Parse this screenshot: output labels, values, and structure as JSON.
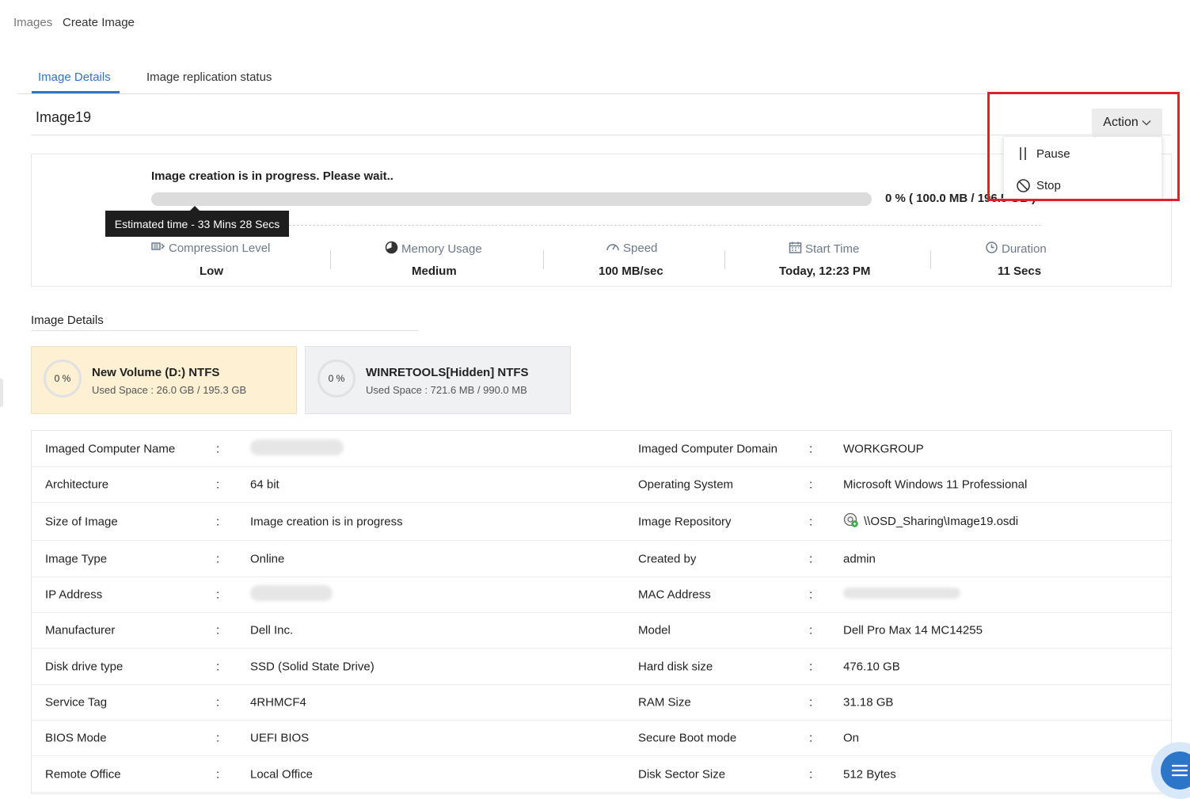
{
  "breadcrumb": [
    "Images",
    "Create Image"
  ],
  "tabs": [
    {
      "label": "Image Details",
      "active": true
    },
    {
      "label": "Image replication status",
      "active": false
    }
  ],
  "image_name": "Image19",
  "action": {
    "button_label": "Action",
    "menu": [
      {
        "label": "Pause",
        "icon": "pause-icon"
      },
      {
        "label": "Stop",
        "icon": "stop-icon"
      }
    ]
  },
  "progress": {
    "message": "Image creation is in progress. Please wait..",
    "percent": 0,
    "summary": "0 % ( 100.0 MB / 196.5 GB )",
    "tooltip": "Estimated time - 33 Mins 28 Secs"
  },
  "stats": [
    {
      "label": "Compression Level",
      "value": "Low",
      "icon": "compression-icon"
    },
    {
      "label": "Memory Usage",
      "value": "Medium",
      "icon": "memory-pie-icon"
    },
    {
      "label": "Speed",
      "value": "100 MB/sec",
      "icon": "speedometer-icon"
    },
    {
      "label": "Start Time",
      "value": "Today, 12:23 PM",
      "icon": "calendar-icon"
    },
    {
      "label": "Duration",
      "value": "11 Secs",
      "icon": "clock-icon"
    }
  ],
  "section_title": "Image Details",
  "volumes": [
    {
      "percent": "0 %",
      "name": "New Volume (D:) NTFS",
      "used": "Used Space : 26.0 GB / 195.3 GB"
    },
    {
      "percent": "0 %",
      "name": "WINRETOOLS[Hidden] NTFS",
      "used": "Used Space : 721.6 MB / 990.0 MB"
    }
  ],
  "details": [
    {
      "label1": "Imaged Computer Name",
      "value1": "",
      "label2": "Imaged Computer Domain",
      "value2": "WORKGROUP"
    },
    {
      "label1": "Architecture",
      "value1": "64 bit",
      "label2": "Operating System",
      "value2": "Microsoft Windows 11 Professional"
    },
    {
      "label1": "Size of Image",
      "value1": "Image creation is in progress",
      "label2": "Image Repository",
      "value2": "\\\\OSD_Sharing\\Image19.osdi"
    },
    {
      "label1": "Image Type",
      "value1": "Online",
      "label2": "Created by",
      "value2": "admin"
    },
    {
      "label1": "IP Address",
      "value1": "",
      "label2": "MAC Address",
      "value2": ""
    },
    {
      "label1": "Manufacturer",
      "value1": "Dell Inc.",
      "label2": "Model",
      "value2": "Dell Pro Max 14 MC14255"
    },
    {
      "label1": "Disk drive type",
      "value1": "SSD (Solid State Drive)",
      "label2": "Hard disk size",
      "value2": "476.10 GB"
    },
    {
      "label1": "Service Tag",
      "value1": "4RHMCF4",
      "label2": "RAM Size",
      "value2": "31.18 GB"
    },
    {
      "label1": "BIOS Mode",
      "value1": "UEFI BIOS",
      "label2": "Secure Boot mode",
      "value2": "On"
    },
    {
      "label1": "Remote Office",
      "value1": "Local Office",
      "label2": "Disk Sector Size",
      "value2": "512 Bytes"
    }
  ],
  "separator": ":",
  "colors": {
    "accent": "#2b76c9",
    "highlight": "#e0202a",
    "volume_active_bg": "#fdf0d3"
  }
}
